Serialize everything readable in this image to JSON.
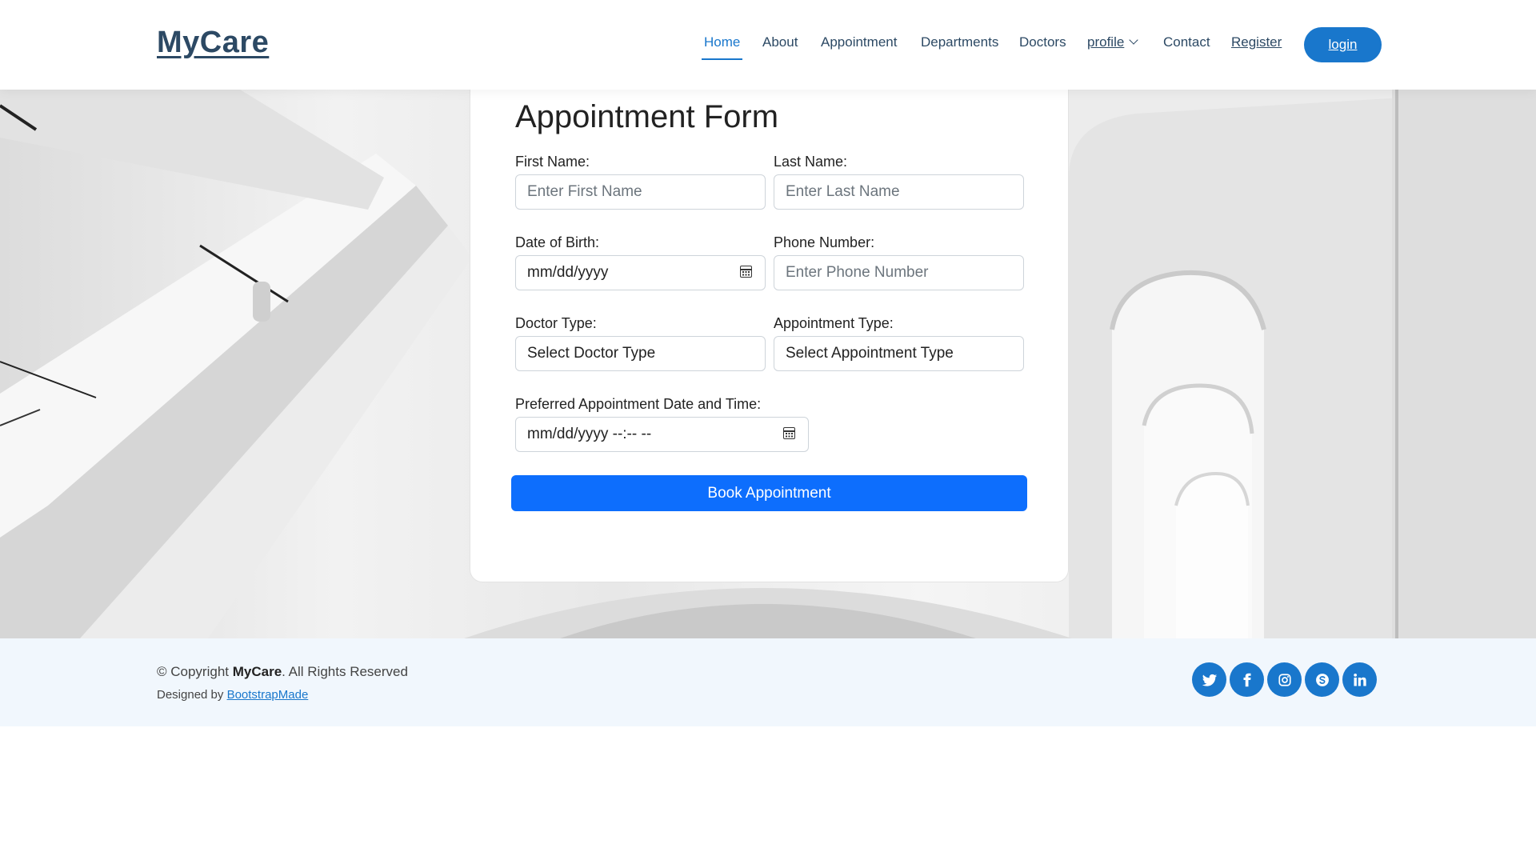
{
  "header": {
    "logo": "MyCare",
    "nav": [
      {
        "label": "Home"
      },
      {
        "label": "About"
      },
      {
        "label": "Appointment"
      },
      {
        "label": "Departments"
      },
      {
        "label": "Doctors"
      },
      {
        "label": "profile"
      },
      {
        "label": "Contact"
      },
      {
        "label": "Register"
      }
    ],
    "login_label": "login",
    "active_color": "#1977cc"
  },
  "form": {
    "title": "Appointment Form",
    "first_name": {
      "label": "First Name:",
      "placeholder": "Enter First Name"
    },
    "last_name": {
      "label": "Last Name:",
      "placeholder": "Enter Last Name"
    },
    "dob": {
      "label": "Date of Birth:",
      "value": "mm/dd/yyyy"
    },
    "phone": {
      "label": "Phone Number:",
      "placeholder": "Enter Phone Number"
    },
    "doctor_type": {
      "label": "Doctor Type:",
      "value": "Select Doctor Type"
    },
    "appointment_type": {
      "label": "Appointment Type:",
      "value": "Select Appointment Type"
    },
    "preferred": {
      "label": "Preferred Appointment Date and Time:",
      "value": "mm/dd/yyyy --:-- --"
    },
    "submit_label": "Book Appointment",
    "submit_color": "#0d6efd"
  },
  "footer": {
    "copyright_prefix": "© Copyright ",
    "copyright_brand": "MyCare",
    "copyright_suffix": ". All Rights Reserved",
    "designed_prefix": "Designed by ",
    "designed_link": "BootstrapMade",
    "social": [
      "twitter-icon",
      "facebook-icon",
      "instagram-icon",
      "skype-icon",
      "linkedin-icon"
    ]
  }
}
